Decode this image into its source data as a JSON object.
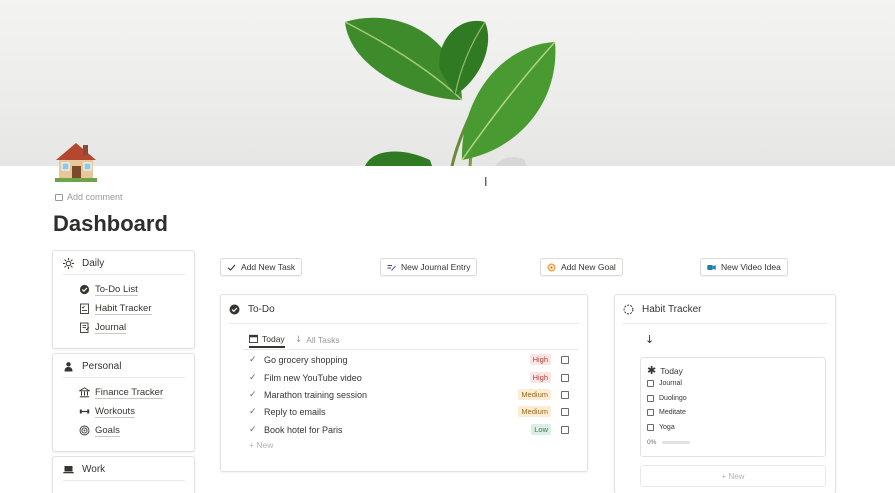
{
  "page": {
    "add_comment": "Add comment",
    "title": "Dashboard",
    "icon": "house-emoji-icon"
  },
  "nav": {
    "daily": {
      "title": "Daily",
      "icon": "sun-icon",
      "items": [
        {
          "label": "To-Do List",
          "icon": "checkmark-circle-icon"
        },
        {
          "label": "Habit Tracker",
          "icon": "checklist-icon"
        },
        {
          "label": "Journal",
          "icon": "notebook-icon"
        }
      ]
    },
    "personal": {
      "title": "Personal",
      "icon": "person-icon",
      "items": [
        {
          "label": "Finance Tracker",
          "icon": "bank-icon"
        },
        {
          "label": "Workouts",
          "icon": "dumbbell-icon"
        },
        {
          "label": "Goals",
          "icon": "target-icon"
        }
      ]
    },
    "work": {
      "title": "Work",
      "icon": "laptop-icon"
    }
  },
  "buttons": {
    "add_task": "Add New Task",
    "journal_entry": "New Journal Entry",
    "add_goal": "Add New Goal",
    "video_idea": "New Video Idea"
  },
  "todo": {
    "title": "To-Do",
    "tabs": [
      "Today",
      "All Tasks"
    ],
    "tasks": [
      {
        "name": "Go grocery shopping",
        "priority": "High",
        "level": "high"
      },
      {
        "name": "Film new YouTube video",
        "priority": "High",
        "level": "high"
      },
      {
        "name": "Marathon training session",
        "priority": "Medium",
        "level": "medium"
      },
      {
        "name": "Reply to emails",
        "priority": "Medium",
        "level": "medium"
      },
      {
        "name": "Book hotel for Paris",
        "priority": "Low",
        "level": "low"
      }
    ],
    "new_label": "+ New"
  },
  "habit": {
    "title": "Habit Tracker",
    "today": "Today",
    "habits": [
      "Journal",
      "Duolingo",
      "Meditate",
      "Yoga"
    ],
    "progress_label": "0%",
    "progress": 0,
    "new_label": "+ New"
  },
  "colors": {
    "high": "#fbe4e4",
    "medium": "#fbecd6",
    "low": "#dcefe4",
    "leaf": "#3f8f2f"
  }
}
